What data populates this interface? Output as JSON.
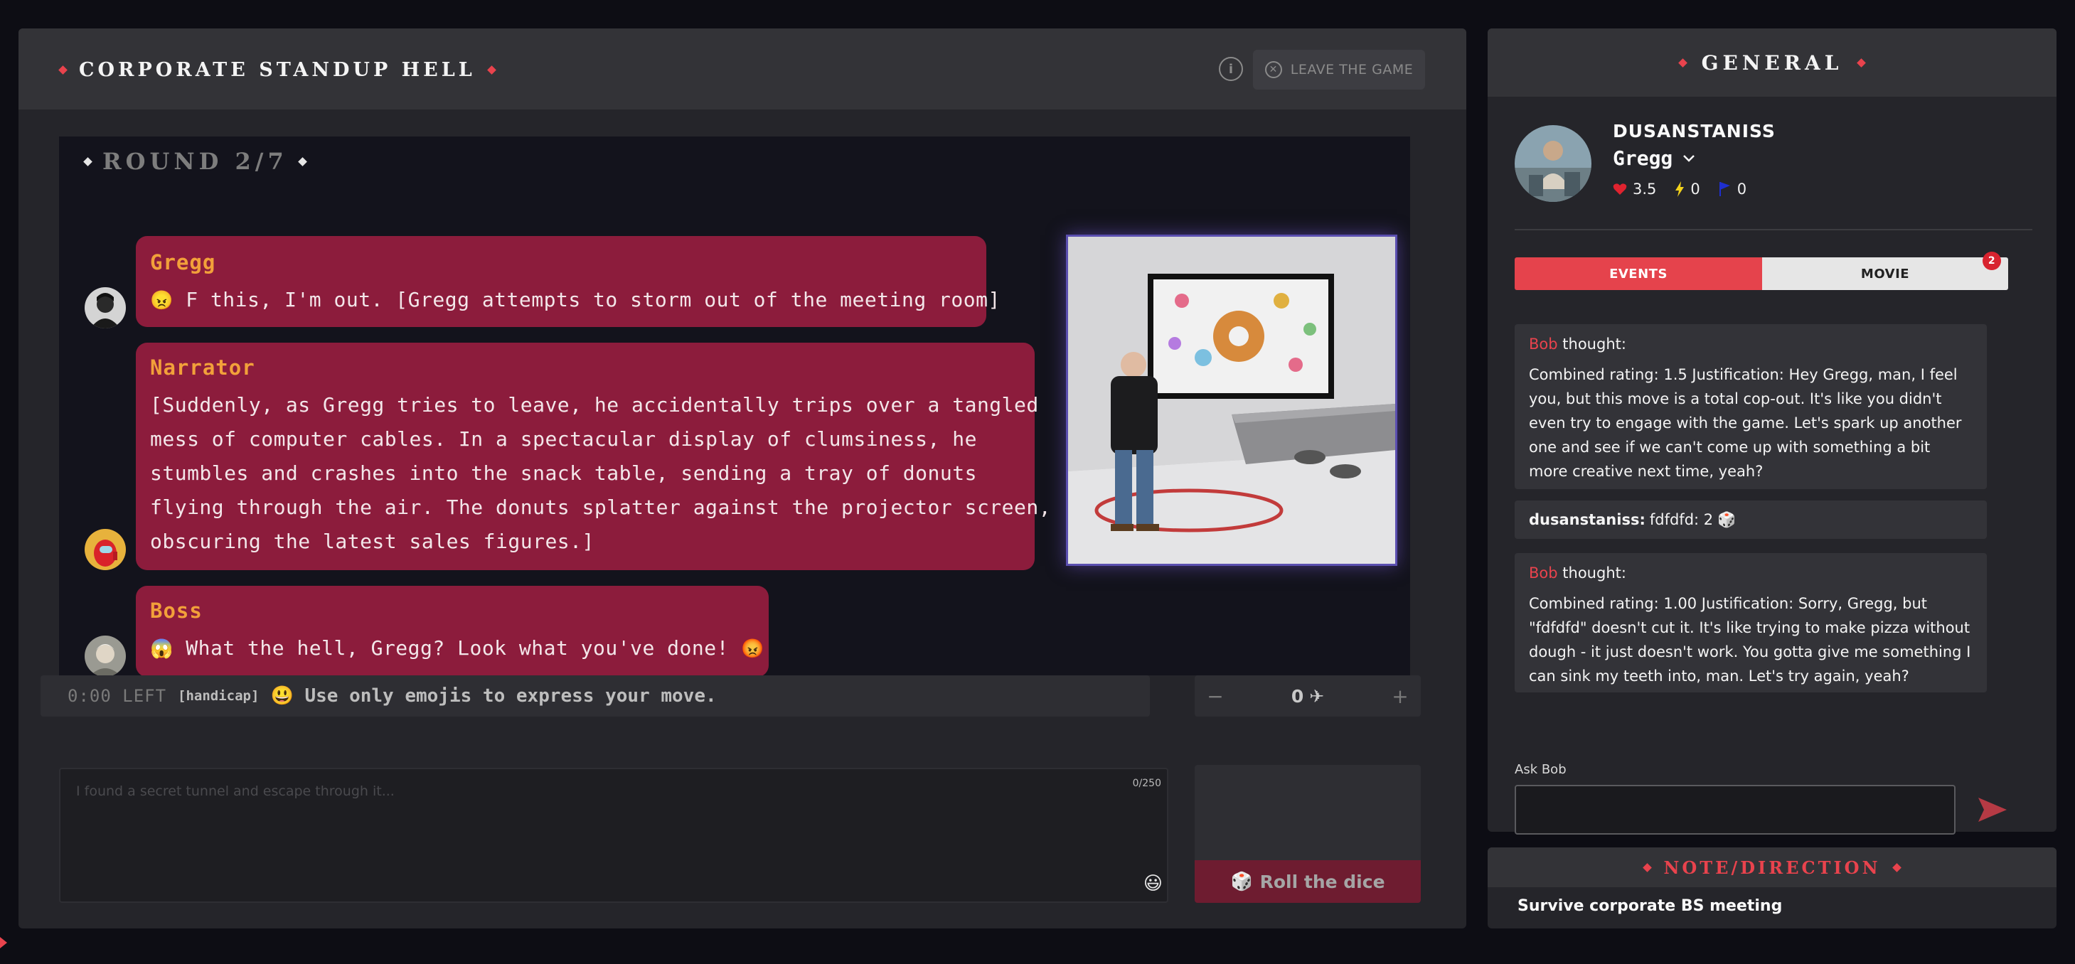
{
  "game": {
    "title": "CORPORATE STANDUP HELL",
    "leave_label": "LEAVE THE GAME",
    "info_icon": "info-icon",
    "round_label": "ROUND 2/7"
  },
  "messages": [
    {
      "speaker": "Gregg",
      "emoji": "😠",
      "text": "F this, I'm out. [Gregg attempts to storm out of the meeting room]"
    },
    {
      "speaker": "Narrator",
      "lines": [
        "[Suddenly, as Gregg tries to leave, he accidentally trips over a tangled",
        "mess of computer cables. In a spectacular display of clumsiness, he",
        "stumbles and crashes into the snack table, sending a tray of donuts",
        "flying through the air. The donuts splatter against the projector screen,",
        "obscuring the latest sales figures.]"
      ]
    },
    {
      "speaker": "Boss",
      "emoji": "😱",
      "text": "What the hell, Gregg? Look what you've done!",
      "emoji_end": "😡"
    }
  ],
  "controls": {
    "timer": "0:00 LEFT",
    "handicap_tag": "[handicap]",
    "handicap_emoji": "😃",
    "handicap_text": "Use only emojis to express your move.",
    "stepper_value": "0",
    "stepper_icon": "✈",
    "minus": "−",
    "plus": "+",
    "input_placeholder": "I found a secret tunnel and escape through it...",
    "char_count": "0/250",
    "emoji_button": "😃",
    "roll_icon": "🎲",
    "roll_label": "Roll the dice"
  },
  "general": {
    "title": "GENERAL",
    "player_name": "DUSANSTANISS",
    "character": "Gregg",
    "stats": {
      "hearts": "3.5",
      "energy": "0",
      "flags": "0"
    },
    "tabs": {
      "events": "EVENTS",
      "movie": "MOVIE",
      "movie_badge": "2"
    },
    "events": [
      {
        "who": "Bob",
        "verb": "thought:",
        "body": "Combined rating: 1.5 Justification: Hey Gregg, man, I feel you, but this move is a total cop-out. It's like you didn't even try to engage with the game. Let's spark up another one and see if we can't come up with something a bit more creative next time, yeah?"
      },
      {
        "user": "dusanstaniss:",
        "text": "fdfdfd: 2",
        "icon": "🎲"
      },
      {
        "who": "Bob",
        "verb": "thought:",
        "body": "Combined rating: 1.00 Justification: Sorry, Gregg, but \"fdfdfd\" doesn't cut it. It's like trying to make pizza without dough - it just doesn't work. You gotta give me something I can sink my teeth into, man. Let's try again, yeah?"
      }
    ],
    "ask_label": "Ask Bob",
    "ask_value": ""
  },
  "note": {
    "title": "NOTE/DIRECTION",
    "text": "Survive corporate BS meeting"
  },
  "colors": {
    "accent_red": "#e9434d",
    "bubble": "#8c1c3c",
    "speaker_orange": "#f2a03a",
    "panel": "#25252a",
    "header": "#333337"
  }
}
